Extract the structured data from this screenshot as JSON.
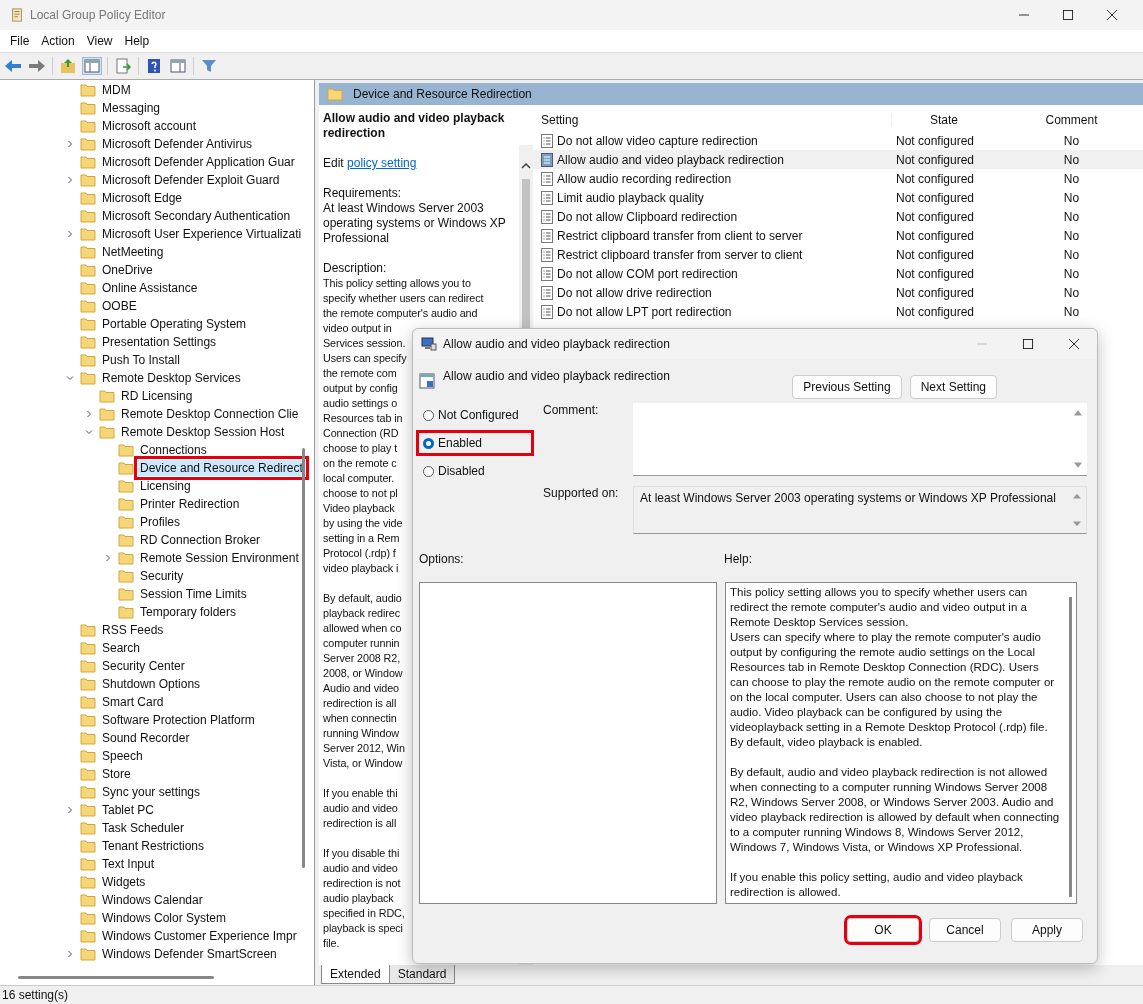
{
  "window": {
    "title": "Local Group Policy Editor"
  },
  "menu": [
    "File",
    "Action",
    "View",
    "Help"
  ],
  "tree": [
    {
      "label": "MDM",
      "selected": false,
      "annotated": false
    },
    {
      "label": "Messaging",
      "selected": false,
      "annotated": false
    },
    {
      "label": "Microsoft account",
      "selected": false,
      "annotated": false
    },
    {
      "label": "Microsoft Defender Antivirus",
      "expanded": false,
      "selected": false,
      "annotated": false
    },
    {
      "label": "Microsoft Defender Application Guar",
      "selected": false,
      "annotated": false
    },
    {
      "label": "Microsoft Defender Exploit Guard",
      "expanded": false,
      "selected": false,
      "annotated": false
    },
    {
      "label": "Microsoft Edge",
      "selected": false,
      "annotated": false
    },
    {
      "label": "Microsoft Secondary Authentication",
      "selected": false,
      "annotated": false
    },
    {
      "label": "Microsoft User Experience Virtualizati",
      "expanded": false,
      "selected": false,
      "annotated": false
    },
    {
      "label": "NetMeeting",
      "selected": false,
      "annotated": false
    },
    {
      "label": "OneDrive",
      "selected": false,
      "annotated": false
    },
    {
      "label": "Online Assistance",
      "selected": false,
      "annotated": false
    },
    {
      "label": "OOBE",
      "selected": false,
      "annotated": false
    },
    {
      "label": "Portable Operating System",
      "selected": false,
      "annotated": false
    },
    {
      "label": "Presentation Settings",
      "selected": false,
      "annotated": false
    },
    {
      "label": "Push To Install",
      "selected": false,
      "annotated": false
    },
    {
      "label": "Remote Desktop Services",
      "expanded": true,
      "selected": false,
      "annotated": false,
      "children": [
        {
          "label": "RD Licensing",
          "selected": false,
          "annotated": false
        },
        {
          "label": "Remote Desktop Connection Clie",
          "expanded": false,
          "selected": false,
          "annotated": false
        },
        {
          "label": "Remote Desktop Session Host",
          "expanded": true,
          "selected": false,
          "annotated": false,
          "children": [
            {
              "label": "Connections",
              "selected": false,
              "annotated": false
            },
            {
              "label": "Device and Resource Redirect",
              "selected": true,
              "annotated": true
            },
            {
              "label": "Licensing",
              "selected": false,
              "annotated": false
            },
            {
              "label": "Printer Redirection",
              "selected": false,
              "annotated": false
            },
            {
              "label": "Profiles",
              "selected": false,
              "annotated": false
            },
            {
              "label": "RD Connection Broker",
              "selected": false,
              "annotated": false
            },
            {
              "label": "Remote Session Environment",
              "expanded": false,
              "selected": false,
              "annotated": false
            },
            {
              "label": "Security",
              "selected": false,
              "annotated": false
            },
            {
              "label": "Session Time Limits",
              "selected": false,
              "annotated": false
            },
            {
              "label": "Temporary folders",
              "selected": false,
              "annotated": false
            }
          ]
        }
      ]
    },
    {
      "label": "RSS Feeds",
      "selected": false,
      "annotated": false
    },
    {
      "label": "Search",
      "selected": false,
      "annotated": false
    },
    {
      "label": "Security Center",
      "selected": false,
      "annotated": false
    },
    {
      "label": "Shutdown Options",
      "selected": false,
      "annotated": false
    },
    {
      "label": "Smart Card",
      "selected": false,
      "annotated": false
    },
    {
      "label": "Software Protection Platform",
      "selected": false,
      "annotated": false
    },
    {
      "label": "Sound Recorder",
      "selected": false,
      "annotated": false
    },
    {
      "label": "Speech",
      "selected": false,
      "annotated": false
    },
    {
      "label": "Store",
      "selected": false,
      "annotated": false
    },
    {
      "label": "Sync your settings",
      "selected": false,
      "annotated": false
    },
    {
      "label": "Tablet PC",
      "expanded": false,
      "selected": false,
      "annotated": false
    },
    {
      "label": "Task Scheduler",
      "selected": false,
      "annotated": false
    },
    {
      "label": "Tenant Restrictions",
      "selected": false,
      "annotated": false
    },
    {
      "label": "Text Input",
      "selected": false,
      "annotated": false
    },
    {
      "label": "Widgets",
      "selected": false,
      "annotated": false
    },
    {
      "label": "Windows Calendar",
      "selected": false,
      "annotated": false
    },
    {
      "label": "Windows Color System",
      "selected": false,
      "annotated": false
    },
    {
      "label": "Windows Customer Experience Impr",
      "selected": false,
      "annotated": false
    },
    {
      "label": "Windows Defender SmartScreen",
      "expanded": false,
      "selected": false,
      "annotated": false
    }
  ],
  "pane_header": "Device and Resource Redirection",
  "description": {
    "title": "Allow audio and video playback redirection",
    "edit_prefix": "Edit",
    "edit_link": "policy setting",
    "requirements_label": "Requirements:",
    "requirements": "At least Windows Server 2003 operating systems or Windows XP Professional",
    "description_label": "Description:",
    "paragraphs": [
      [
        "This policy setting allows you to",
        "specify whether users can redirect",
        "the remote computer's audio and",
        "video output in",
        "Services session.",
        "Users can specify",
        "the remote com",
        "output by config",
        "audio settings o",
        "Resources tab in",
        "Connection (RD",
        "choose to play t",
        "on the remote c",
        "local computer.",
        "choose to not pl",
        "Video playback",
        "by using the vide",
        "setting in a Rem",
        "Protocol (.rdp) f",
        "video playback i"
      ],
      [
        "By default, audio",
        "playback redirec",
        "allowed when co",
        "computer runnin",
        "Server 2008 R2,",
        "2008, or Window",
        "Audio and video",
        "redirection is all",
        "when connectin",
        "running Window",
        "Server 2012, Win",
        "Vista, or Window"
      ],
      [
        "If you enable thi",
        "audio and video",
        "redirection is all"
      ],
      [
        "If you disable thi",
        "audio and video",
        "redirection is not",
        "audio playback",
        "specified in RDC,",
        "playback is speci",
        "file."
      ]
    ]
  },
  "table": {
    "columns": [
      "Setting",
      "State",
      "Comment"
    ],
    "rows": [
      {
        "setting": "Do not allow video capture redirection",
        "state": "Not configured",
        "comment": "No",
        "selected": false
      },
      {
        "setting": "Allow audio and video playback redirection",
        "state": "Not configured",
        "comment": "No",
        "selected": true
      },
      {
        "setting": "Allow audio recording redirection",
        "state": "Not configured",
        "comment": "No",
        "selected": false
      },
      {
        "setting": "Limit audio playback quality",
        "state": "Not configured",
        "comment": "No",
        "selected": false
      },
      {
        "setting": "Do not allow Clipboard redirection",
        "state": "Not configured",
        "comment": "No",
        "selected": false
      },
      {
        "setting": "Restrict clipboard transfer from client to server",
        "state": "Not configured",
        "comment": "No",
        "selected": false
      },
      {
        "setting": "Restrict clipboard transfer from server to client",
        "state": "Not configured",
        "comment": "No",
        "selected": false
      },
      {
        "setting": "Do not allow COM port redirection",
        "state": "Not configured",
        "comment": "No",
        "selected": false
      },
      {
        "setting": "Do not allow drive redirection",
        "state": "Not configured",
        "comment": "No",
        "selected": false
      },
      {
        "setting": "Do not allow LPT port redirection",
        "state": "Not configured",
        "comment": "No",
        "selected": false
      }
    ]
  },
  "view_tabs": [
    {
      "label": "Extended",
      "selected": true
    },
    {
      "label": "Standard",
      "selected": false
    }
  ],
  "status_bar": "16 setting(s)",
  "dialog": {
    "title": "Allow audio and video playback redirection",
    "heading": "Allow audio and video playback redirection",
    "nav_buttons": [
      "Previous Setting",
      "Next Setting"
    ],
    "options": [
      {
        "label": "Not Configured",
        "selected": false,
        "annotated": false
      },
      {
        "label": "Enabled",
        "selected": true,
        "annotated": true
      },
      {
        "label": "Disabled",
        "selected": false,
        "annotated": false
      }
    ],
    "comment_label": "Comment:",
    "supported_label": "Supported on:",
    "supported": "At least Windows Server 2003 operating systems or Windows XP Professional",
    "options_label": "Options:",
    "help_label": "Help:",
    "help": [
      "This policy setting allows you to specify whether users can redirect the remote computer's audio and video output in a Remote Desktop Services session.\nUsers can specify where to play the remote computer's audio output by configuring the remote audio settings on the Local Resources tab in Remote Desktop Connection (RDC). Users can choose to play the remote audio on the remote computer or on the local computer. Users can also choose to not play the audio. Video playback can be configured by using the videoplayback setting in a Remote Desktop Protocol (.rdp) file. By default, video playback is enabled.",
      "By default, audio and video playback redirection is not allowed when connecting to a computer running Windows Server 2008 R2, Windows Server 2008, or Windows Server 2003. Audio and video playback redirection is allowed by default when connecting to a computer running Windows 8, Windows Server 2012, Windows 7, Windows Vista, or Windows XP Professional.",
      "If you enable this policy setting, audio and video playback redirection is allowed."
    ],
    "buttons": [
      {
        "label": "OK",
        "annotated": true
      },
      {
        "label": "Cancel",
        "annotated": false
      },
      {
        "label": "Apply",
        "annotated": false
      }
    ]
  }
}
